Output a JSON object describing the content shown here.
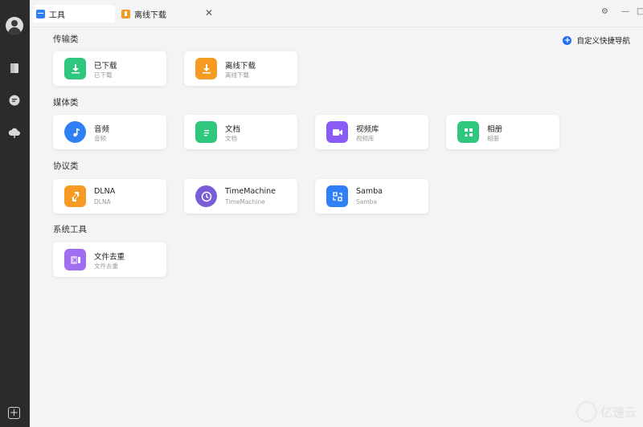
{
  "sidebar": {
    "icons": [
      "avatar-icon",
      "document-icon",
      "chat-icon",
      "cloud-icon",
      "add-icon"
    ]
  },
  "tabs": [
    {
      "label": "工具",
      "icon": "toolbox-icon"
    },
    {
      "label": "离线下载",
      "icon": "offline-download-icon",
      "close": "✕"
    }
  ],
  "window_controls": {
    "settings": "⚙",
    "minimize": "—",
    "maximize": "□"
  },
  "quick_nav": {
    "label": "自定义快捷导航",
    "icon": "+"
  },
  "sections": [
    {
      "title": "传输类",
      "items": [
        {
          "title": "已下载",
          "sub": "已下载",
          "icon": "downloaded-icon",
          "color": "#2fc77d"
        },
        {
          "title": "离线下载",
          "sub": "离线下载",
          "icon": "offline-download-icon",
          "color": "#f59a23"
        }
      ]
    },
    {
      "title": "媒体类",
      "items": [
        {
          "title": "音频",
          "sub": "音频",
          "icon": "music-icon",
          "color": "#2f7ff5"
        },
        {
          "title": "文档",
          "sub": "文档",
          "icon": "document-icon",
          "color": "#2fc77d"
        },
        {
          "title": "视频库",
          "sub": "视频库",
          "icon": "video-icon",
          "color": "#8a5cf6"
        },
        {
          "title": "相册",
          "sub": "相册",
          "icon": "album-icon",
          "color": "#2fc77d"
        }
      ]
    },
    {
      "title": "协议类",
      "items": [
        {
          "title": "DLNA",
          "sub": "DLNA",
          "icon": "dlna-icon",
          "color": "#f59a23"
        },
        {
          "title": "TimeMachine",
          "sub": "TimeMachine",
          "icon": "clock-icon",
          "color": "#7a5cd6"
        },
        {
          "title": "Samba",
          "sub": "Samba",
          "icon": "samba-icon",
          "color": "#2f7ff5"
        }
      ]
    },
    {
      "title": "系统工具",
      "items": [
        {
          "title": "文件去重",
          "sub": "文件去重",
          "icon": "dedupe-icon",
          "color": "#a06ef0"
        }
      ]
    }
  ],
  "watermark": {
    "text": "亿速云"
  }
}
